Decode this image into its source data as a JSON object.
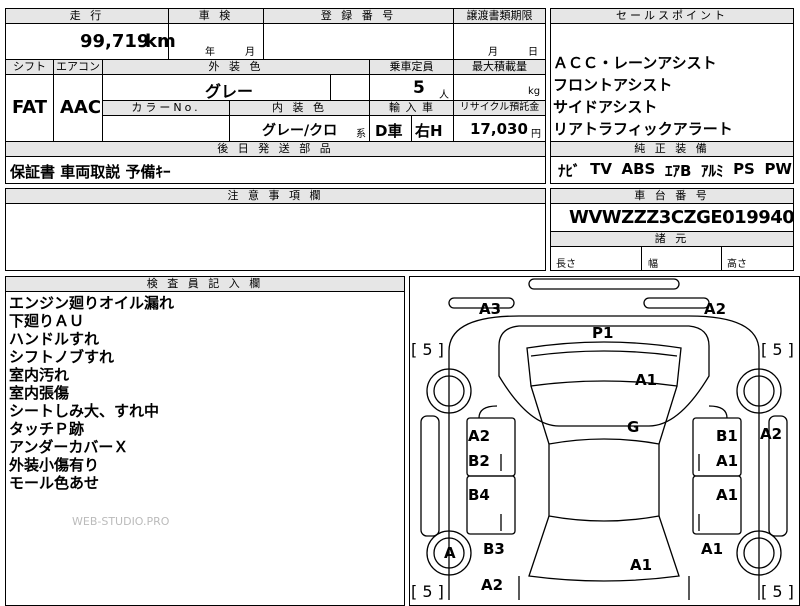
{
  "header_top": {
    "frag1": "",
    "frag2": "",
    "frag3": ""
  },
  "mileage": {
    "label": "走 行",
    "value": "99,719",
    "unit": "km"
  },
  "inspection": {
    "label": "車 検",
    "year_unit": "年",
    "month_unit": "月"
  },
  "registration": {
    "label": "登 録 番 号"
  },
  "transfer": {
    "label": "譲渡書類期限",
    "month_unit": "月",
    "day_unit": "日"
  },
  "shift": {
    "label": "シフト",
    "value": "FAT"
  },
  "aircon": {
    "label": "エアコン",
    "value": "AAC"
  },
  "exterior_color": {
    "label": "外 装 色",
    "value": "グレー"
  },
  "capacity": {
    "label": "乗車定員",
    "value": "5",
    "unit": "人"
  },
  "max_load": {
    "label": "最大積載量",
    "unit": "kg"
  },
  "color_no": {
    "label": "カラーNo."
  },
  "interior_color": {
    "label": "内 装 色",
    "value": "グレー/クロ",
    "suffix": "系"
  },
  "import": {
    "label": "輸 入 車",
    "d": "D車",
    "h": "右H"
  },
  "recycle": {
    "label": "リサイクル預託金",
    "value": "17,030",
    "unit": "円"
  },
  "later_parts": {
    "label": "後 日 発 送 部 品",
    "value": "保証書 車両取説 予備ｷｰ"
  },
  "sales_points": {
    "label": "セールスポイント",
    "items": [
      "ＡＣＣ・レーンアシスト",
      "フロントアシスト",
      "サイドアシスト",
      "リアトラフィックアラート"
    ]
  },
  "equipment": {
    "label": "純 正 装 備",
    "items": [
      "ﾅﾋﾞ",
      "TV",
      "ABS",
      "ｴｱB",
      "ｱﾙﾐ",
      "PS",
      "PW"
    ]
  },
  "caution": {
    "label": "注 意 事 項 欄"
  },
  "chassis": {
    "label": "車 台 番 号",
    "value": "WVWZZZ3CZGE019940"
  },
  "dimensions": {
    "label": "諸 元",
    "length": "長さ",
    "width": "幅",
    "height": "高さ"
  },
  "inspector": {
    "label": "検 査 員 記 入 欄",
    "notes": [
      "エンジン廻りオイル漏れ",
      "下廻りＡＵ",
      "ハンドルすれ",
      "シフトノブすれ",
      "室内汚れ",
      "室内張傷",
      "シートしみ大、すれ中",
      "タッチＰ跡",
      "アンダーカバーＸ",
      "外装小傷有り",
      "モール色あせ"
    ]
  },
  "watermark": "WEB-STUDIO.PRO",
  "diagram": {
    "tyre_fl": "[ 5 ]",
    "tyre_fr": "[ 5 ]",
    "tyre_rl": "[ 5 ]",
    "tyre_rr": "[ 5 ]",
    "marks": {
      "a3_front_left": "A3",
      "a2_front_right": "A2",
      "p1_windshield": "P1",
      "a1_hood": "A1",
      "g_roof": "G",
      "a2_left_front_door": "A2",
      "b2_left_front_door": "B2",
      "b1_right_front_door": "B1",
      "a1_right_front_door": "A1",
      "a2_right_fender": "A2",
      "b4_left_rear_door": "B4",
      "a1_right_rear_door": "A1",
      "a_left_rear_wheel": "A",
      "b3_left_quarter": "B3",
      "a1_trunk": "A1",
      "a1_right_quarter": "A1",
      "a2_rear_left": "A2"
    }
  }
}
